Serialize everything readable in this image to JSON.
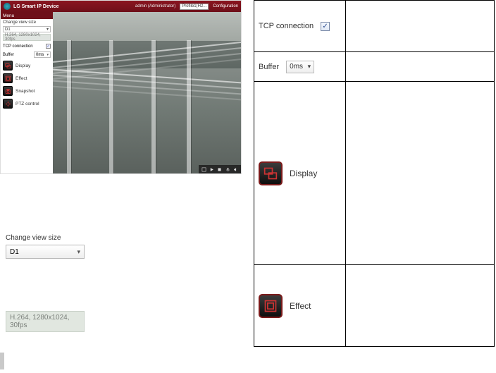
{
  "app": {
    "brand_line": "LG Smart\nIP Device",
    "user_label": "admin (Administrator)",
    "profile_selected": "Profile1(H2...",
    "config_link": "Configuration",
    "menu_header": "Menu",
    "change_view_size_label": "Change view size",
    "change_view_size_value": "D1",
    "stream_info": "H.264, 1280x1024, 30fps",
    "tcp_label": "TCP connection",
    "tcp_checked": "✓",
    "buffer_label": "Buffer",
    "buffer_value": "0ms",
    "items": [
      {
        "name": "display",
        "label": "Display"
      },
      {
        "name": "effect",
        "label": "Effect"
      },
      {
        "name": "snapshot",
        "label": "Snapshot"
      },
      {
        "name": "ptz",
        "label": "PTZ control"
      }
    ]
  },
  "panels": {
    "viewsize_label": "Change view size",
    "viewsize_value": "D1",
    "infobox_text": "H.264, 1280x1024, 30fps"
  },
  "table": {
    "tcp_label": "TCP connection",
    "tcp_checked": "✓",
    "buffer_label": "Buffer",
    "buffer_value": "0ms",
    "display_label": "Display",
    "effect_label": "Effect"
  }
}
